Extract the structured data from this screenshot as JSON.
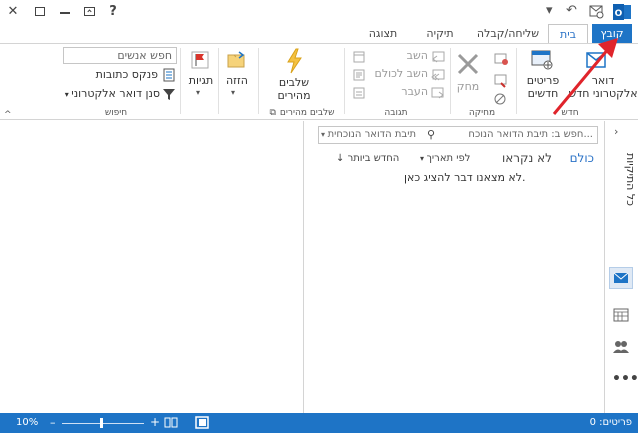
{
  "window": {
    "help_label": "?",
    "file_tab": "קובץ",
    "tabs": [
      "בית",
      "שליחה/קבלה",
      "תיקיה",
      "תצוגה"
    ]
  },
  "ribbon": {
    "new_group": {
      "label": "חדש",
      "new_email": "דואר\nאלקטרוני חדש",
      "new_items": "פריטים\nחדשים"
    },
    "delete_group": {
      "label": "מחיקה",
      "delete": "מחק"
    },
    "respond_group": {
      "label": "תגובה",
      "reply": "השב",
      "reply_all": "השב לכולם",
      "forward": "העבר"
    },
    "quicksteps_group": {
      "label": "שלבים מהירים",
      "quicksteps": "שלבים\nמהירים"
    },
    "move_group": {
      "move": "הזזה"
    },
    "tags_group": {
      "tags": "תגיות"
    },
    "find_group": {
      "label": "חיפוש",
      "search_people_placeholder": "חפש אנשים",
      "address_book": "פנקס כתובות",
      "filter_email": "סנן דואר אלקטרוני"
    }
  },
  "leftpane": {
    "all_folders": "כל התיקיות"
  },
  "msglist": {
    "search_placeholder": "חפש ב: תיבת הדואר הנוכח...",
    "scope": "תיבת הדואר הנוכחית",
    "filter_all": "כולם",
    "filter_unread": "לא נקראו",
    "sort_by": "לפי תאריך",
    "sort_order": "החדש ביותר",
    "empty_message": "לא מצאנו דבר להציג כאן."
  },
  "status": {
    "items": "פריטים: 0",
    "zoom": "10%"
  },
  "colors": {
    "accent": "#1e74c6",
    "arrow": "#e0242b"
  }
}
